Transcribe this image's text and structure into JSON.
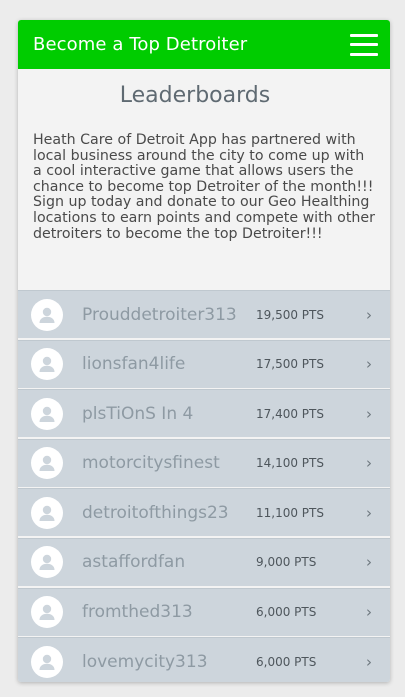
{
  "header": {
    "title": "Become a Top Detroiter",
    "menu_icon": "hamburger-menu-icon"
  },
  "main": {
    "heading": "Leaderboards",
    "intro": "Heath Care of Detroit App has partnered with local business around the city to come up with a cool interactive game that allows users the chance to become top Detroiter of the month!!! Sign up today and donate to our Geo Healthing locations to earn points and compete with other detroiters to become the top Detroiter!!!"
  },
  "leaderboard": [
    {
      "name": "Prouddetroiter313",
      "points": "19,500 PTS"
    },
    {
      "name": "lionsfan4life",
      "points": "17,500 PTS"
    },
    {
      "name": "plsTiOnS In 4",
      "points": "17,400 PTS"
    },
    {
      "name": "motorcitysfinest",
      "points": "14,100 PTS"
    },
    {
      "name": "detroitofthings23",
      "points": "11,100 PTS"
    },
    {
      "name": "astaffordfan",
      "points": "9,000 PTS"
    },
    {
      "name": "fromthed313",
      "points": "6,000 PTS"
    },
    {
      "name": "lovemycity313",
      "points": "6,000 PTS"
    }
  ],
  "colors": {
    "appbar": "#00cc00",
    "row_background": "#cdd5dc",
    "avatar_icon": "#cdd5dc"
  },
  "row_icons": {
    "avatar": "user-avatar-icon",
    "chevron": "chevron-right-icon"
  }
}
